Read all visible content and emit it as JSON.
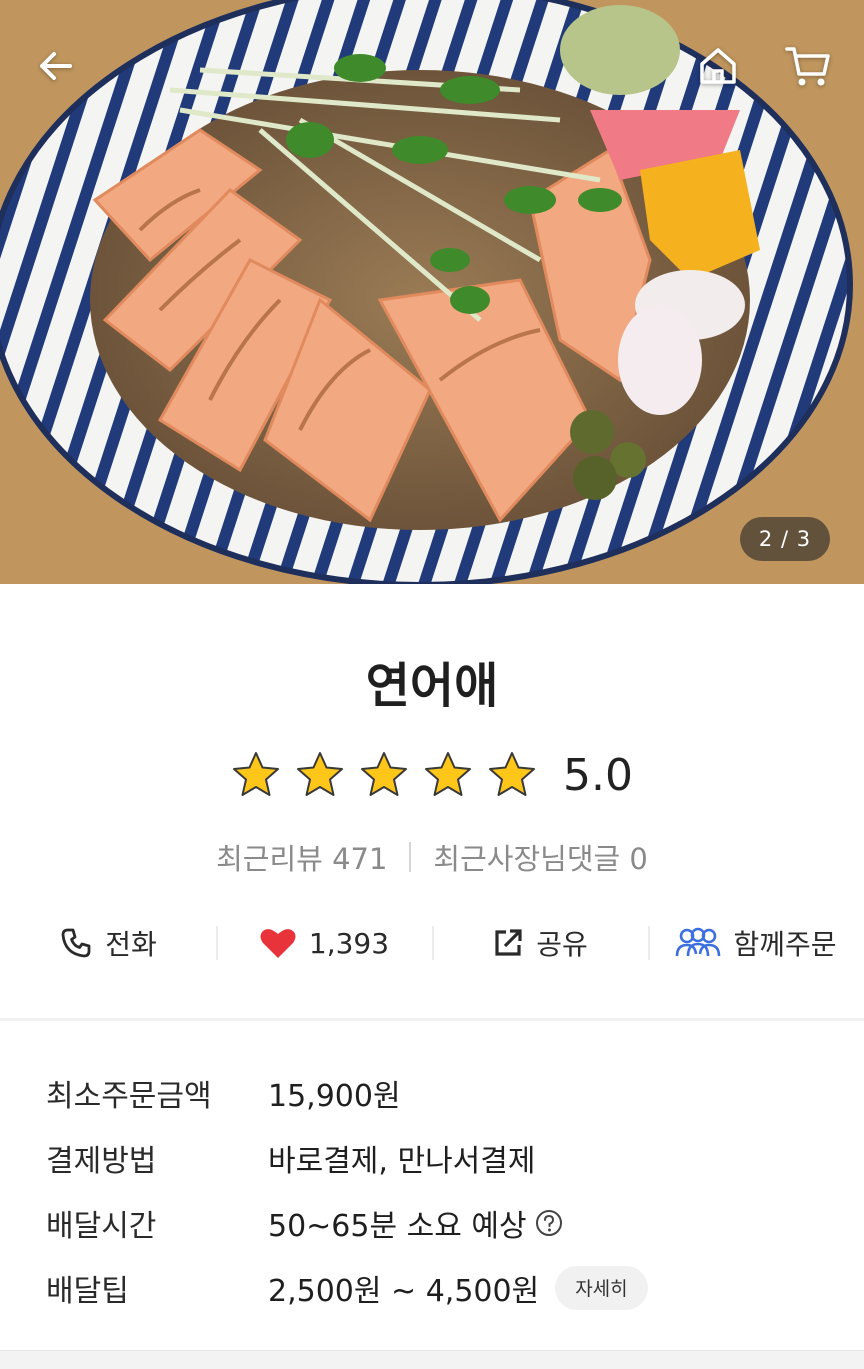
{
  "nav": {
    "back_icon": "arrow-left-icon",
    "home_icon": "home-icon",
    "cart_icon": "cart-icon"
  },
  "hero": {
    "image_description": "photo",
    "page_indicator": "2 / 3"
  },
  "store": {
    "name": "연어애",
    "rating": "5.0",
    "stars_filled": 5,
    "recent_reviews_label": "최근리뷰 471",
    "owner_comments_label": "최근사장님댓글 0"
  },
  "actions": [
    {
      "label": "전화",
      "icon": "phone-icon"
    },
    {
      "label": "1,393",
      "icon": "heart-icon"
    },
    {
      "label": "공유",
      "icon": "share-icon"
    },
    {
      "label": "함께주문",
      "icon": "group-icon"
    }
  ],
  "info": {
    "min_order_label": "최소주문금액",
    "min_order_value": "15,900원",
    "payment_label": "결제방법",
    "payment_value": "바로결제, 만나서결제",
    "delivery_time_label": "배달시간",
    "delivery_time_value": "50~65분 소요 예상",
    "delivery_tip_label": "배달팁",
    "delivery_tip_value": "2,500원 ~ 4,500원",
    "detail_button": "자세히"
  },
  "colors": {
    "star": "#FFC61A",
    "heart": "#E8333A",
    "group_icon": "#3B6FE0",
    "text_primary": "#222222",
    "text_muted": "#8A8A8A"
  }
}
